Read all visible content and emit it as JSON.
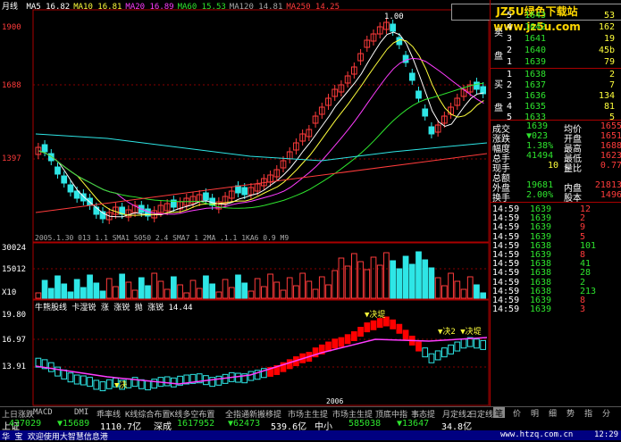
{
  "chart": {
    "title": "月线",
    "ma_legend": [
      {
        "label": "MA5",
        "value": "16.82",
        "color": "#ffffff"
      },
      {
        "label": "MA10",
        "value": "16.81",
        "color": "#ffff3c"
      },
      {
        "label": "MA20",
        "value": "16.89",
        "color": "#ff3cff"
      },
      {
        "label": "MA60",
        "value": "15.53",
        "color": "#2ee52e"
      },
      {
        "label": "MA120",
        "value": "14.81",
        "color": "#a8a8a8"
      },
      {
        "label": "MA250",
        "value": "14.25",
        "color": "#ff3b3b"
      }
    ],
    "price_ticks": [
      "1900",
      "1688",
      "1397"
    ],
    "volume_ticks": [
      "30024",
      "15012",
      "X10"
    ],
    "indicator_ticks": [
      "19.80",
      "16.97",
      "13.91"
    ],
    "mid_label": "2005.1.30   013   1.1 SMA1  5050  2.4  SMA7 1 2MA  .1.1  1KA6 0.9 M9",
    "indicator_title": "牛熊股线  卡湿锐  涨  涨锐  抛  涨锐  14.44",
    "annotation_top": "1.00",
    "annot_labels": [
      "▼决堤",
      "▼决2 ▼决堤",
      "▼决"
    ],
    "year_label": "2006"
  },
  "logo_text": "JZ5U绿色下载站 www.jz5u.com",
  "orderbook": {
    "sell_label": "卖",
    "sell_label2": "盘",
    "buy_label": "买",
    "buy_label2": "盘",
    "asks": [
      {
        "level": "5",
        "price": "1643",
        "vol": "53"
      },
      {
        "level": "4",
        "price": "1642",
        "vol": "162"
      },
      {
        "level": "3",
        "price": "1641",
        "vol": "19"
      },
      {
        "level": "2",
        "price": "1640",
        "vol": "45b"
      },
      {
        "level": "1",
        "price": "1639",
        "vol": "79"
      }
    ],
    "bids": [
      {
        "level": "1",
        "price": "1638",
        "vol": "2"
      },
      {
        "level": "2",
        "price": "1637",
        "vol": "7"
      },
      {
        "level": "3",
        "price": "1636",
        "vol": "134"
      },
      {
        "level": "4",
        "price": "1635",
        "vol": "81"
      },
      {
        "level": "5",
        "price": "1633",
        "vol": "5"
      }
    ]
  },
  "stats": [
    {
      "k": "成交",
      "v": "1639",
      "k2": "均价",
      "v2": "1655"
    },
    {
      "k": "涨跌",
      "v": "▼023",
      "k2": "开盘",
      "v2": "1651"
    },
    {
      "k": "幅度",
      "v": "1.38%",
      "k2": "最高",
      "v2": "1688"
    },
    {
      "k": "总手",
      "v": "41494",
      "k2": "最低",
      "v2": "1623"
    },
    {
      "k": "现手",
      "v": "",
      "k2": "量比",
      "v2": "0.77"
    },
    {
      "k": "总额",
      "v": "",
      "k2": "",
      "v2": ""
    },
    {
      "k": "外盘",
      "v": "19681",
      "k2": "内盘",
      "v2": "21813"
    },
    {
      "k": "换手",
      "v": "2.00%",
      "k2": "股本",
      "v2": "1496"
    }
  ],
  "stat_extra": {
    "xianshou": "10",
    "xianshou_dir": "卜"
  },
  "trades": [
    {
      "time": "14:59",
      "price": "1639",
      "vol": "12",
      "dir": "red"
    },
    {
      "time": "14:59",
      "price": "1639",
      "vol": "2",
      "dir": "red"
    },
    {
      "time": "14:59",
      "price": "1639",
      "vol": "9",
      "dir": "red"
    },
    {
      "time": "14:59",
      "price": "1639",
      "vol": "5",
      "dir": "red"
    },
    {
      "time": "14:59",
      "price": "1638",
      "vol": "101",
      "dir": "green"
    },
    {
      "time": "14:59",
      "price": "1639",
      "vol": "8",
      "dir": "red"
    },
    {
      "time": "14:59",
      "price": "1638",
      "vol": "41",
      "dir": "green"
    },
    {
      "time": "14:59",
      "price": "1638",
      "vol": "28",
      "dir": "green"
    },
    {
      "time": "14:59",
      "price": "1638",
      "vol": "2",
      "dir": "green"
    },
    {
      "time": "14:59",
      "price": "1638",
      "vol": "213",
      "dir": "green"
    },
    {
      "time": "14:59",
      "price": "1639",
      "vol": "8",
      "dir": "red"
    },
    {
      "time": "14:59",
      "price": "1639",
      "vol": "3",
      "dir": "red"
    }
  ],
  "tabs": [
    "上日涨跌",
    "MACD",
    "DMI",
    "乖率线",
    "K线综合布置",
    "K线多空布置",
    "全指通新搬移提",
    "市场主生提",
    "市场主生提",
    "顶底中指",
    "事态提",
    "月定线2",
    "日定线"
  ],
  "right_tabs": [
    "笔",
    "价",
    "明",
    "细",
    "势",
    "指",
    "分"
  ],
  "ticker": [
    {
      "text": "上证",
      "cls": "wht"
    },
    {
      "text": "437029",
      "cls": "green"
    },
    {
      "text": "▼15689",
      "cls": "green"
    },
    {
      "text": "1110.7亿",
      "cls": "wht"
    },
    {
      "text": "深成",
      "cls": "wht"
    },
    {
      "text": "1617952",
      "cls": "green"
    },
    {
      "text": "▼62473",
      "cls": "green"
    },
    {
      "text": "539.6亿",
      "cls": "wht"
    },
    {
      "text": "中小",
      "cls": "wht"
    },
    {
      "text": "585038",
      "cls": "green"
    },
    {
      "text": "▼13647",
      "cls": "green"
    },
    {
      "text": "34.8亿",
      "cls": "wht"
    }
  ],
  "status": {
    "left": "华 宝 欢迎使用大智慧信息港",
    "mid": "www.htzq.com.cn",
    "time": "12:29"
  }
}
